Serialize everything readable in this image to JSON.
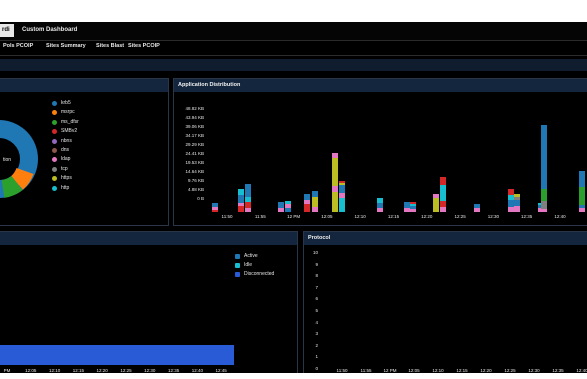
{
  "tabs": {
    "active_fragment": "rdi",
    "custom": "Custom Dashboard"
  },
  "subtabs": [
    "Pols PCOIP",
    "Sites Summary",
    "Sites Blast",
    "Sites PCOIP"
  ],
  "donut": {
    "center_text": "tion",
    "legend": [
      {
        "label": "krb5",
        "color": "#1f77b4"
      },
      {
        "label": "msrpc",
        "color": "#ff7f0e"
      },
      {
        "label": "ms_dfsr",
        "color": "#2ca02c"
      },
      {
        "label": "SMBv2",
        "color": "#d62728"
      },
      {
        "label": "nbns",
        "color": "#9467bd"
      },
      {
        "label": "dns",
        "color": "#8c564b"
      },
      {
        "label": "ldap",
        "color": "#e377c2"
      },
      {
        "label": "tcp",
        "color": "#7f7f7f"
      },
      {
        "label": "https",
        "color": "#bcbd22"
      },
      {
        "label": "http",
        "color": "#17becf"
      }
    ]
  },
  "app_dist": {
    "title": "Application Distribution",
    "chart_data": {
      "type": "bar",
      "stacked": true,
      "y_ticks": [
        "48.82 KB",
        "43.94 KB",
        "39.06 KB",
        "34.17 KB",
        "29.29 KB",
        "24.41 KB",
        "19.53 KB",
        "14.64 KB",
        "9.76 KB",
        "4.88 KB",
        "0 B"
      ],
      "x_ticks": [
        "11:50",
        "11:55",
        "12 PM",
        "12:05",
        "12:10",
        "12:15",
        "12:20",
        "12:25",
        "12:30",
        "12:35",
        "12:40"
      ],
      "series_colors": {
        "krb5": "#1f77b4",
        "msrpc": "#ff7f0e",
        "ms_dfsr": "#2ca02c",
        "SMBv2": "#d62728",
        "ldap": "#e377c2",
        "tcp": "#7f7f7f",
        "https": "#bcbd22",
        "http": "#17becf"
      }
    }
  },
  "sessions": {
    "legend": [
      {
        "label": "Active",
        "color": "#1f77b4"
      },
      {
        "label": "Idle",
        "color": "#17becf"
      },
      {
        "label": "Disconnected",
        "color": "#2a5bd7"
      }
    ],
    "x_ticks": [
      "PM",
      "12:05",
      "12:10",
      "12:15",
      "12:20",
      "12:25",
      "12:30",
      "12:35",
      "12:40",
      "12:45"
    ]
  },
  "protocol": {
    "title": "Protocol",
    "y_ticks": [
      "10",
      "9",
      "8",
      "7",
      "6",
      "5",
      "4",
      "3",
      "2",
      "1",
      "0"
    ],
    "x_ticks": [
      "11:50",
      "11:55",
      "12 PM",
      "12:05",
      "12:10",
      "12:15",
      "12:20",
      "12:25",
      "12:30",
      "12:35",
      "12:40"
    ]
  }
}
